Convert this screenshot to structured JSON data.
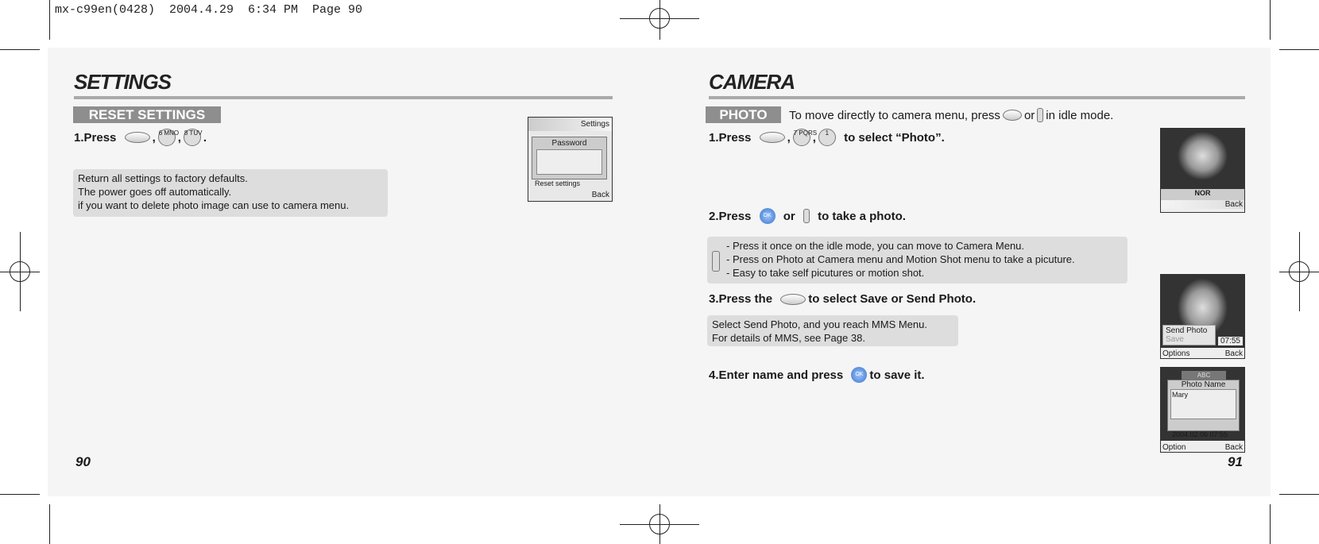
{
  "header": "mx-c99en(0428)  2004.4.29  6:34 PM  Page 90",
  "left": {
    "title": "SETTINGS",
    "badge": "RESET SETTINGS",
    "step1": {
      "prefix": "1.Press",
      "keys": [
        "Menu",
        "6 MNO",
        "8 TUV"
      ],
      "sep": ",",
      "end": "."
    },
    "note": [
      "Return all settings to factory defaults.",
      "The power goes off automatically.",
      "if you want to delete photo image can use to camera menu."
    ],
    "screen": {
      "title": "Settings",
      "dialog": "Password",
      "item": "Reset settings",
      "back": "Back"
    },
    "page_number": "90"
  },
  "right": {
    "title": "CAMERA",
    "badge": "PHOTO",
    "intro": {
      "a": "To move directly to camera menu, press",
      "b": "or",
      "c": "in idle mode."
    },
    "step1": {
      "prefix": "1.Press",
      "keys": [
        "Menu",
        "7 PQRS",
        "1"
      ],
      "suffix": "to select “Photo”."
    },
    "step2": {
      "prefix": "2.Press",
      "or": "or",
      "suffix": "to take a photo."
    },
    "note2": [
      "- Press it once on the idle mode, you can move to Camera Menu.",
      "- Press on Photo at Camera menu and Motion Shot menu to take a picuture.",
      "- Easy to take self picutures or motion shot."
    ],
    "step3": {
      "prefix": "3.Press the",
      "suffix": "to select Save or Send Photo."
    },
    "note3": [
      "Select Send Photo, and you reach MMS Menu.",
      "For details of MMS, see Page 38."
    ],
    "step4": {
      "prefix": "4.Enter name and press",
      "suffix": "to save it."
    },
    "screen1": {
      "mode": "NOR",
      "back": "Back"
    },
    "screen2": {
      "menu": [
        "Send Photo",
        "Save"
      ],
      "time": "07:55",
      "left": "Options",
      "back": "Back"
    },
    "screen3": {
      "input_mode": "ABC",
      "title": "Photo Name",
      "value": "Mary",
      "date": "2004.02.06  07:55",
      "left": "Option",
      "back": "Back"
    },
    "page_number": "91"
  }
}
